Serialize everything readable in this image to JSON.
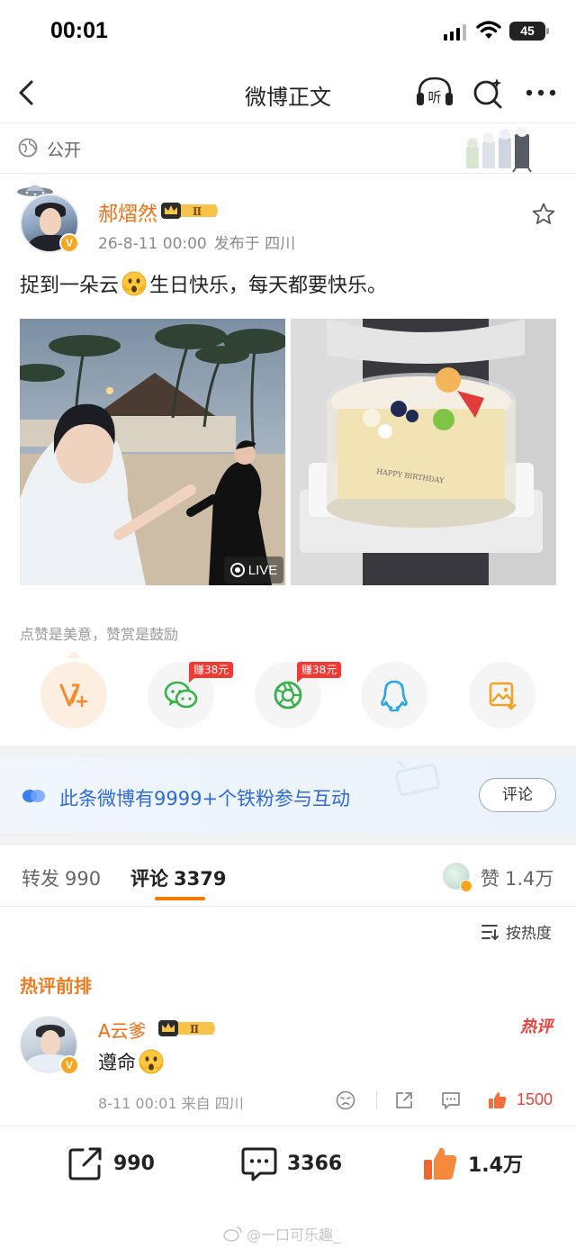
{
  "status_bar": {
    "time": "00:01",
    "battery": "45"
  },
  "nav": {
    "title": "微博正文",
    "listen_label": "听"
  },
  "visibility": {
    "label": "公开"
  },
  "post": {
    "author": "郝熠然",
    "vip_level": "Ⅱ",
    "verified_mark": "V",
    "date": "26-8-11 00:00",
    "source": "发布于 四川",
    "text_before": "捉到一朵云",
    "text_after": "生日快乐，每天都要快乐。",
    "live_label": "LIVE",
    "cake_text": "HAPPY BIRTHDAY"
  },
  "reward_hint": "点赞是美意，赞赏是鼓励",
  "share": {
    "earn_wechat": "赚38元",
    "earn_moments": "赚38元"
  },
  "fans_banner": {
    "text": "此条微博有9999+个铁粉参与互动",
    "button": "评论"
  },
  "tabs": {
    "repost": {
      "label": "转发",
      "count": "990"
    },
    "comment": {
      "label": "评论",
      "count": "3379"
    },
    "like": {
      "label": "赞",
      "count": "1.4万"
    }
  },
  "sort": {
    "label": "按热度"
  },
  "hot_section": {
    "title": "热评前排"
  },
  "comment": {
    "author": "A云爹",
    "vip_level": "Ⅱ",
    "text": "遵命",
    "hot_tag": "热评",
    "time": "8-11 00:01",
    "source": "来自 四川",
    "likes": "1500"
  },
  "bottom_bar": {
    "repost_count": "990",
    "comment_count": "3366",
    "like_count": "1.4万"
  },
  "watermark": "@一口可乐趣_",
  "colors": {
    "accent": "#f57c00",
    "author_name": "#f26b0f",
    "link_blue": "#2f6ad8",
    "hot_red": "#e8423b"
  }
}
